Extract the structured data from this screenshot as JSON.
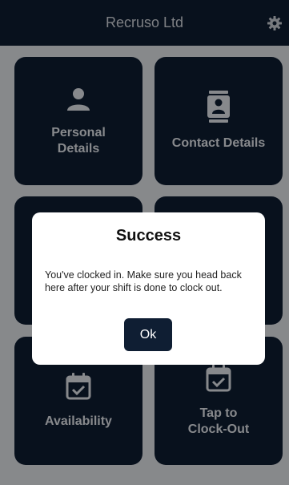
{
  "app": {
    "title": "Recruso Ltd"
  },
  "tiles": [
    {
      "label": "Personal Details",
      "icon": "person-icon"
    },
    {
      "label": "Contact Details",
      "icon": "contact-card-icon"
    },
    {
      "label": "",
      "icon": ""
    },
    {
      "label": "",
      "icon": ""
    },
    {
      "label": "Availability",
      "icon": "calendar-check-icon"
    },
    {
      "label": "Tap to Clock-Out",
      "icon": "calendar-check-icon"
    }
  ],
  "dialog": {
    "title": "Success",
    "message": "You've clocked in. Make sure you head back here after your shift is done to clock out.",
    "ok_label": "Ok"
  },
  "colors": {
    "primary": "#0f1e33",
    "background": "#e9ecf0"
  }
}
